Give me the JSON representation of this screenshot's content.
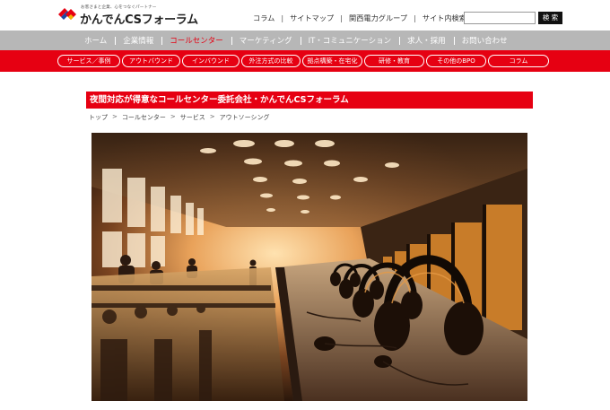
{
  "logo": {
    "tagline": "お客さまと企業、心をつなぐパートナー",
    "name": "かんでんCSフォーラム",
    "colors": {
      "red": "#e60012",
      "blue": "#1d4aa3",
      "yellow": "#f2b705"
    }
  },
  "utility_nav": {
    "items": [
      "コラム",
      "サイトマップ",
      "関西電力グループ",
      "サイト内検索"
    ],
    "search": {
      "value": "",
      "placeholder": "",
      "button_label": "検 索"
    }
  },
  "main_nav": {
    "items": [
      "ホーム",
      "企業情報",
      "コールセンター",
      "マーケティング",
      "IT・コミュニケーション",
      "求人・採用",
      "お問い合わせ"
    ],
    "active": "コールセンター"
  },
  "sub_nav": {
    "items": [
      "サービス／事例",
      "アウトバウンド",
      "インバウンド",
      "外注方式の比較",
      "拠点構築・在宅化",
      "研修・教育",
      "その他のBPO",
      "コラム"
    ]
  },
  "page": {
    "heading": "夜間対応が得意なコールセンター委託会社・かんでんCSフォーラム",
    "breadcrumb": [
      "トップ",
      "コールセンター",
      "サービス",
      "アウトソーシング"
    ],
    "hero_image": "call-center-headset-photo"
  },
  "colors": {
    "brand_red": "#e60012",
    "nav_grey": "#b7b7b7"
  }
}
